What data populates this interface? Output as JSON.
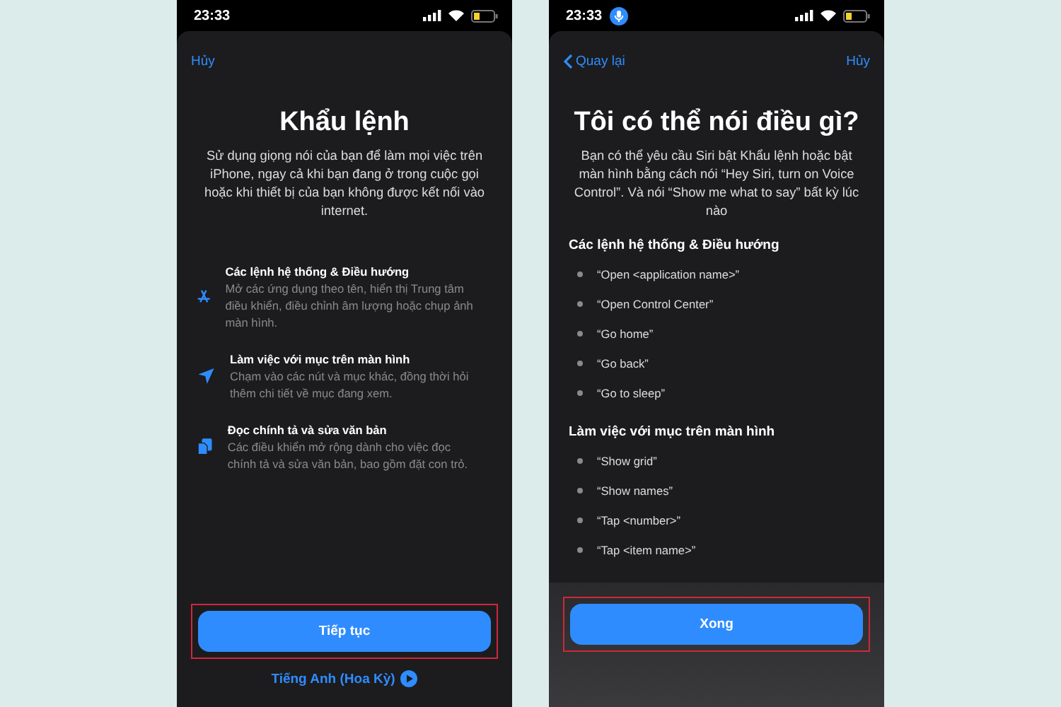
{
  "screens": [
    {
      "kind": "intro",
      "status": {
        "time": "23:33",
        "mic_active": false
      },
      "nav": {
        "cancel": "Hủy"
      },
      "title": "Khẩu lệnh",
      "description": "Sử dụng giọng nói của bạn để làm mọi việc trên iPhone, ngay cả khi bạn đang ở trong cuộc gọi hoặc khi thiết bị của bạn không được kết nối vào internet.",
      "features": [
        {
          "kind": "apps",
          "title": "Các lệnh hệ thống & Điều hướng",
          "text": "Mở các ứng dụng theo tên, hiển thị Trung tâm điều khiển, điều chỉnh âm lượng hoặc chụp ảnh màn hình."
        },
        {
          "kind": "tap",
          "title": "Làm việc với mục trên màn hình",
          "text": "Chạm vào các nút và mục khác, đồng thời hỏi thêm chi tiết về mục đang xem."
        },
        {
          "kind": "dictation",
          "title": "Đọc chính tả và sửa văn bản",
          "text": "Các điều khiển mở rộng dành cho việc đọc chính tả và sửa văn bản, bao gồm đặt con trỏ."
        }
      ],
      "button": {
        "label": "Tiếp tục",
        "highlighted": true
      },
      "language_link": "Tiếng Anh (Hoa Kỳ)"
    },
    {
      "kind": "commands",
      "status": {
        "time": "23:33",
        "mic_active": true
      },
      "nav": {
        "back": "Quay lại",
        "cancel": "Hủy"
      },
      "title": "Tôi có thể nói điều gì?",
      "description": "Bạn có thể yêu cầu Siri bật Khẩu lệnh hoặc bật màn hình bằng cách nói “Hey Siri, turn on Voice Control”. Và nói “Show me what to say” bất kỳ lúc nào",
      "sections": [
        {
          "heading": "Các lệnh hệ thống & Điều hướng",
          "items": [
            "“Open <application name>”",
            "“Open Control Center”",
            "“Go home”",
            "“Go back”",
            "“Go to sleep”"
          ]
        },
        {
          "heading": "Làm việc với mục trên màn hình",
          "items": [
            "“Show grid”",
            "“Show names”",
            "“Tap <number>”",
            "“Tap <item name>”"
          ]
        }
      ],
      "button": {
        "label": "Xong",
        "highlighted": true
      }
    }
  ]
}
